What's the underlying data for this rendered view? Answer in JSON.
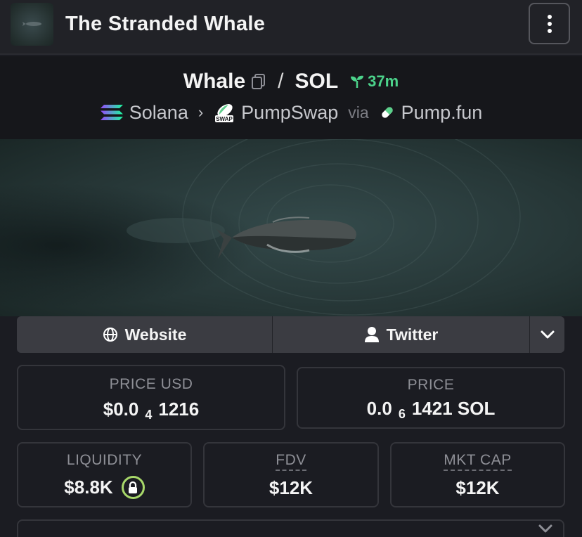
{
  "header": {
    "title": "The Stranded Whale"
  },
  "pair": {
    "base": "Whale",
    "slash": "/",
    "quote": "SOL",
    "age": "37m"
  },
  "route": {
    "chain": "Solana",
    "dex": "PumpSwap",
    "via": "via",
    "launchpad": "Pump.fun",
    "dex_badge": "SWAP"
  },
  "links": {
    "website": "Website",
    "twitter": "Twitter"
  },
  "stats": {
    "price_usd": {
      "label": "PRICE USD",
      "prefix": "$0.0",
      "zeros": "4",
      "digits": "1216"
    },
    "price": {
      "label": "PRICE",
      "prefix": "0.0",
      "zeros": "6",
      "digits": "1421 SOL"
    },
    "liquidity": {
      "label": "LIQUIDITY",
      "value": "$8.8K"
    },
    "fdv": {
      "label": "FDV",
      "value": "$12K"
    },
    "mkt_cap": {
      "label": "MKT CAP",
      "value": "$12K"
    }
  },
  "colors": {
    "accent_green": "#4cd38b",
    "lock_green": "#a8d86a",
    "background": "#1b1c22"
  }
}
